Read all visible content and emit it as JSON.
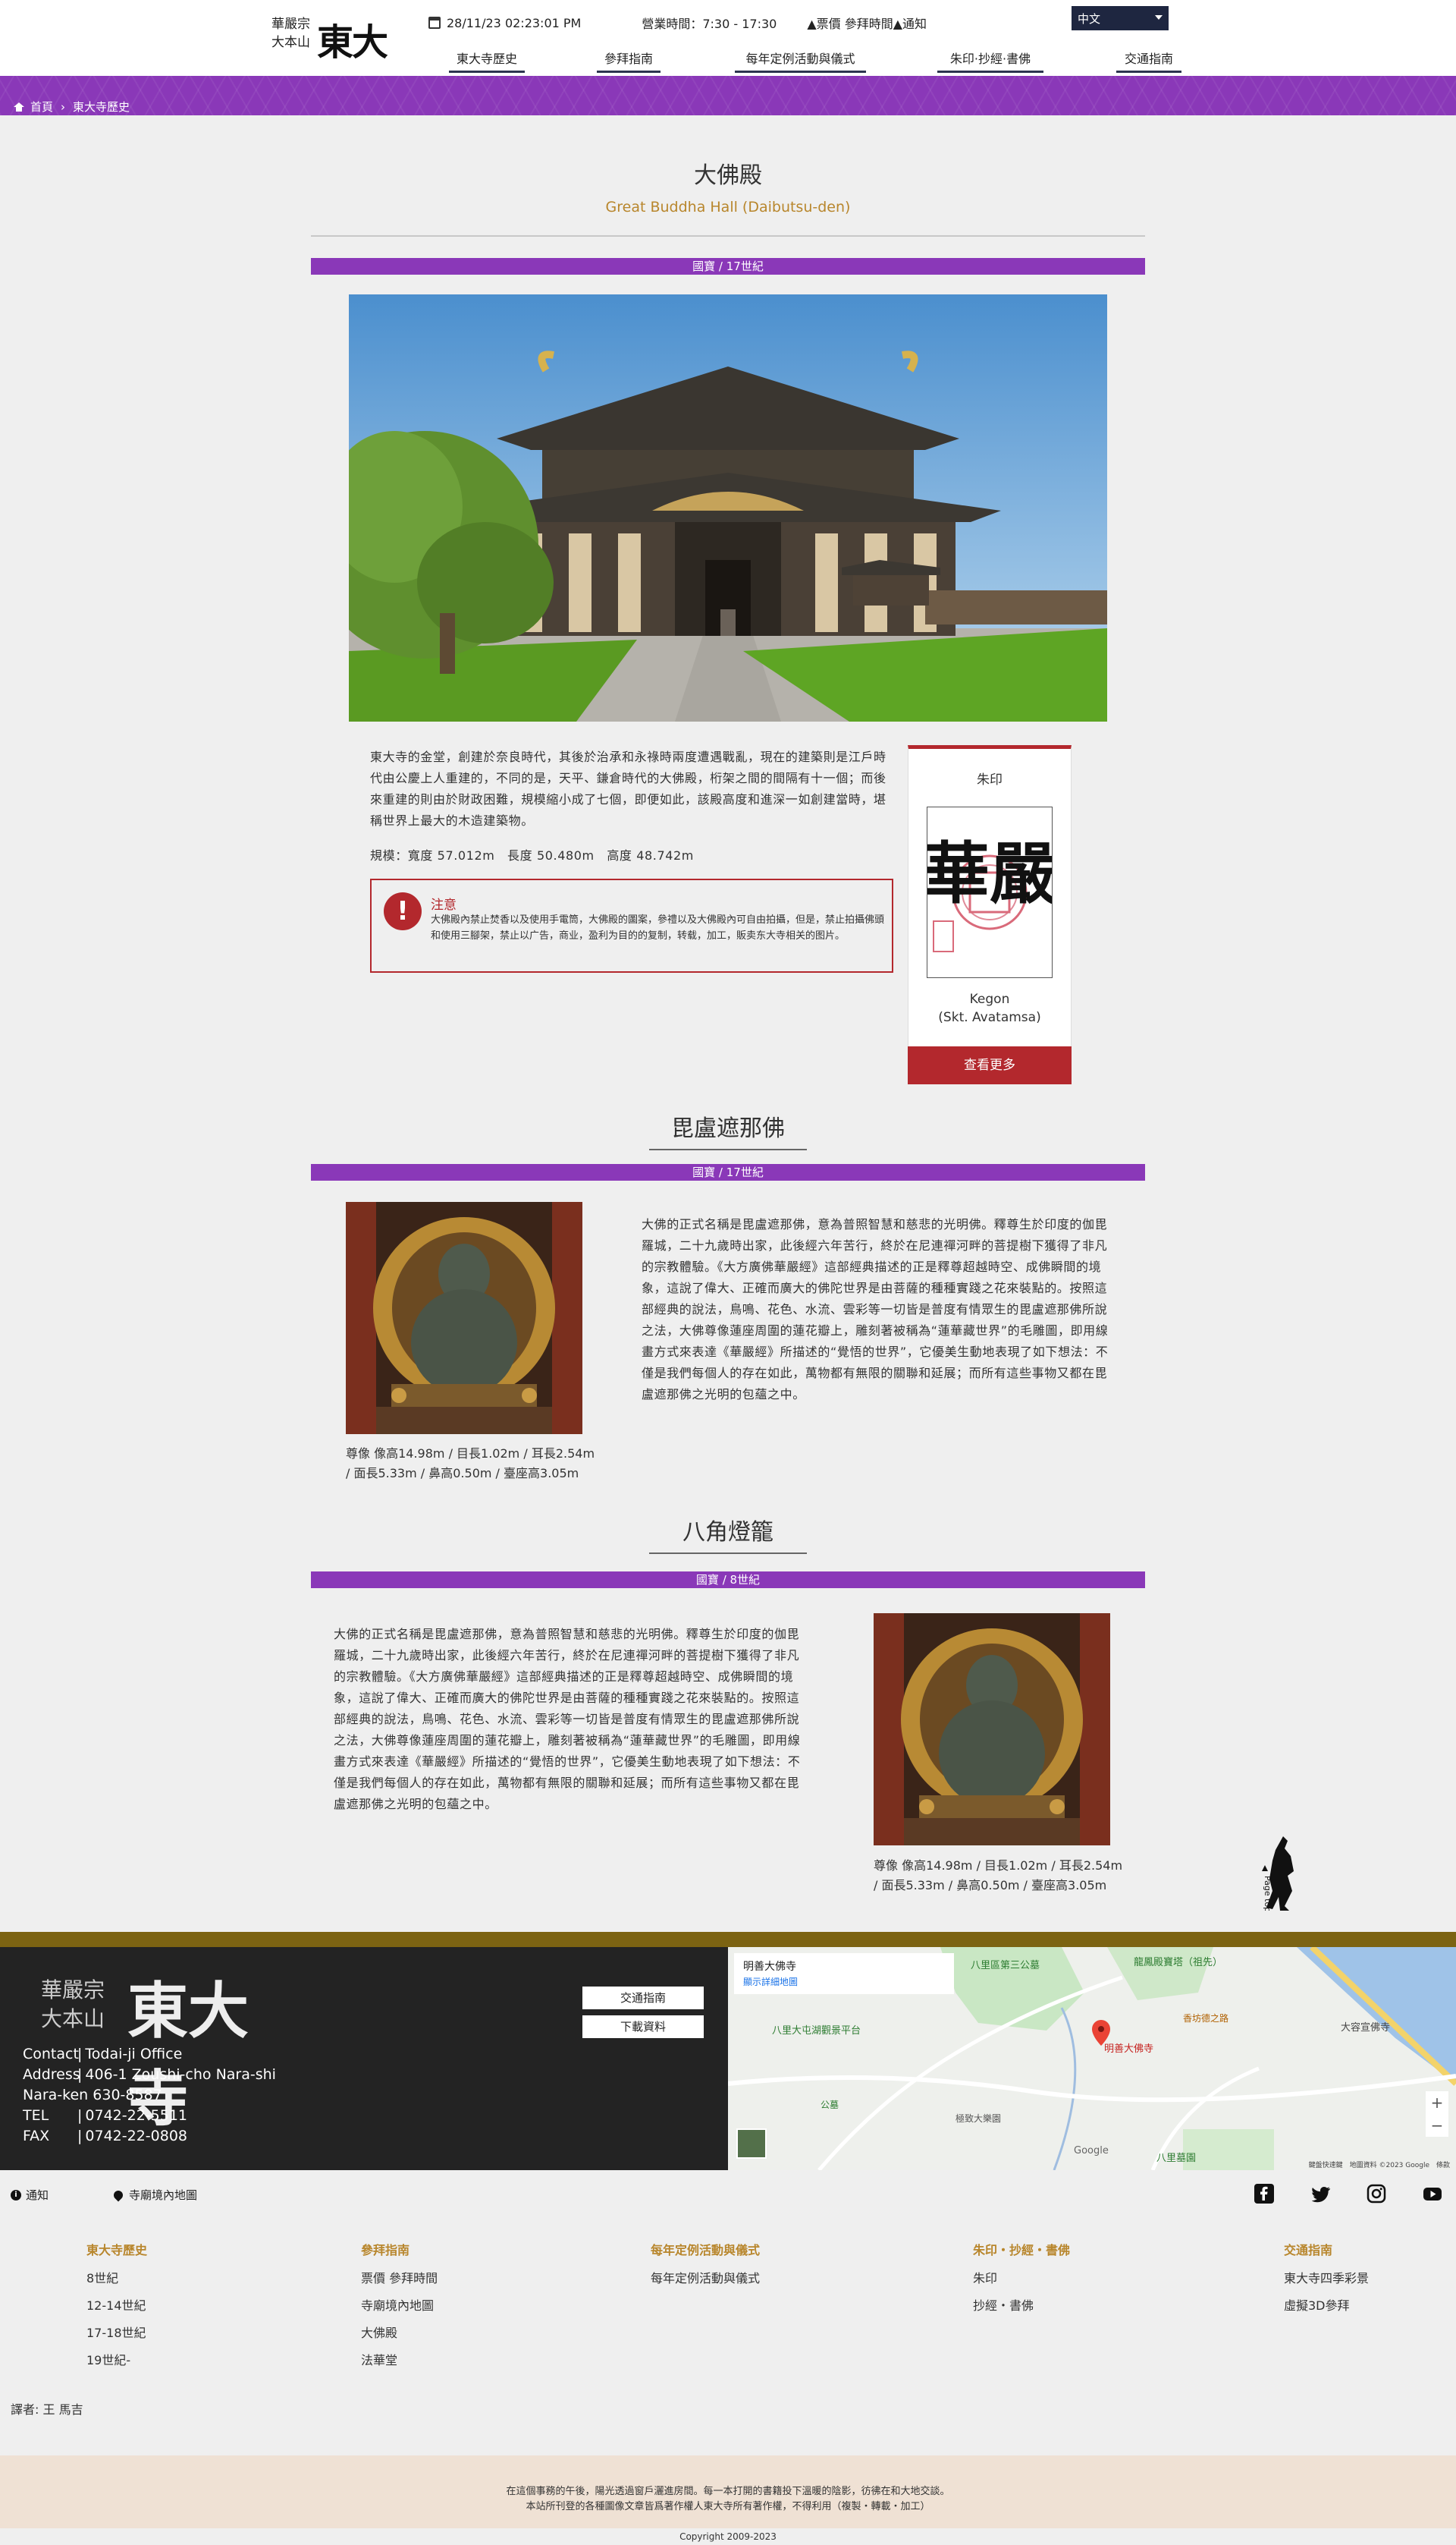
{
  "header": {
    "logo_sect": "華嚴宗\n大本山",
    "logo_mark": "東大寺",
    "datetime": "28/11/23  02:23:01 PM",
    "hours": "營業時間：7:30 - 17:30",
    "ticket_link": "▲票價 參拜時間",
    "notice_link": "▲通知",
    "language": "中文",
    "nav": [
      "東大寺歷史",
      "參拜指南",
      "每年定例活動與儀式",
      "朱印·抄經·書佛",
      "交通指南"
    ]
  },
  "breadcrumb": {
    "home": "首頁",
    "current": "東大寺歷史"
  },
  "daibutsuden": {
    "title": "大佛殿",
    "subtitle": "Great Buddha Hall (Daibutsu-den)",
    "ribbon": "國寶 / 17世紀",
    "body": "東大寺的金堂，創建於奈良時代，其後於治承和永祿時兩度遭遇戰亂，現在的建築則是江戶時代由公慶上人重建的，不同的是，天平、鎌倉時代的大佛殿，桁架之間的間隔有十一個；而後來重建的則由於財政困難，規模縮小成了七個，即便如此，該殿高度和進深一如創建當時，堪稱世界上最大的木造建築物。",
    "specs": "規模：寬度 57.012m　長度 50.480m　高度 48.742m",
    "notice_title": "注意",
    "notice_text": "大佛殿內禁止焚香以及使用手電筒，大佛殿的圖案，參禮以及大佛殿內可自由拍攝，但是，禁止拍攝佛頭和使用三腳架，禁止以广告，商业，盈利为目的的复制，转载，加工，販卖东大寺相关的图片。"
  },
  "shuin_card": {
    "heading": "朱印",
    "seal_glyph": "華嚴",
    "caption_1": "Kegon",
    "caption_2": "(Skt. Avatamsa)",
    "button": "查看更多"
  },
  "vairocana": {
    "title": "毘盧遮那佛",
    "ribbon": "國寶 / 17世紀",
    "body": "大佛的正式名稱是毘盧遮那佛，意為普照智慧和慈悲的光明佛。釋尊生於印度的伽毘羅城，二十九歲時出家，此後經六年苦行，終於在尼連禪河畔的菩提樹下獲得了非凡的宗教體驗。《大方廣佛華嚴經》這部經典描述的正是釋尊超越時空、成佛瞬間的境象，這說了偉大、正確而廣大的佛陀世界是由菩薩的種種實踐之花來裝點的。按照這部經典的說法，鳥鳴、花色、水流、雲彩等一切皆是普度有情眾生的毘盧遮那佛所說之法，大佛尊像蓮座周圍的蓮花瓣上，雕刻著被稱為“蓮華藏世界”的毛雕圖，即用線畫方式來表達《華嚴經》所描述的“覺悟的世界”，它優美生動地表現了如下想法：不僅是我們每個人的存在如此，萬物都有無限的關聯和延展；而所有這些事物又都在毘盧遮那佛之光明的包蘊之中。",
    "caption": "尊像 像高14.98m / 目長1.02m / 耳長2.54m / 面長5.33m / 鼻高0.50m / 臺座高3.05m"
  },
  "lantern": {
    "title": "八角燈籠",
    "ribbon": "國寶 / 8世紀",
    "body": "大佛的正式名稱是毘盧遮那佛，意為普照智慧和慈悲的光明佛。釋尊生於印度的伽毘羅城，二十九歲時出家，此後經六年苦行，終於在尼連禪河畔的菩提樹下獲得了非凡的宗教體驗。《大方廣佛華嚴經》這部經典描述的正是釋尊超越時空、成佛瞬間的境象，這說了偉大、正確而廣大的佛陀世界是由菩薩的種種實踐之花來裝點的。按照這部經典的說法，鳥鳴、花色、水流、雲彩等一切皆是普度有情眾生的毘盧遮那佛所說之法，大佛尊像蓮座周圍的蓮花瓣上，雕刻著被稱為“蓮華藏世界”的毛雕圖，即用線畫方式來表達《華嚴經》所描述的“覺悟的世界”，它優美生動地表現了如下想法：不僅是我們每個人的存在如此，萬物都有無限的關聯和延展；而所有這些事物又都在毘盧遮那佛之光明的包蘊之中。",
    "caption": "尊像 像高14.98m / 目長1.02m / 耳長2.54m / 面長5.33m / 鼻高0.50m / 臺座高3.05m"
  },
  "page_top": "Page top",
  "footer": {
    "logo_sect": "華嚴宗\n大本山",
    "logo_mark": "東大寺",
    "contact_label": "Contact",
    "contact_value": "Todai-ji Office",
    "address_label": "Address",
    "address_value": "406-1 Zoushi-cho Nara-shi",
    "address_line2": "Nara-ken 630-8587",
    "tel_label": "TEL",
    "tel_value": "0742-22-5511",
    "fax_label": "FAX",
    "fax_value": "0742-22-0808",
    "btn_access": "交通指南",
    "btn_download": "下載資料",
    "map": {
      "place_title": "明善大佛寺",
      "place_link": "顯示詳細地圖",
      "pin_label": "明善大佛寺",
      "labels": [
        "八里區第三公墓",
        "龍鳳殿寶塔（祖先）",
        "八里大屯湖觀景平台",
        "香坊德之路",
        "大容宣佛寺",
        "公墓",
        "極致大樂園",
        "八里墓園"
      ],
      "google": "Google",
      "terms": "鍵盤快速鍵　地圖資料 ©2023 Google　條款"
    },
    "sub_links": {
      "notice": "通知",
      "map": "寺廟境內地圖"
    },
    "columns": [
      {
        "heading": "東大寺歷史",
        "items": [
          "8世紀",
          "12-14世紀",
          "17-18世紀",
          "19世紀-"
        ]
      },
      {
        "heading": "參拜指南",
        "items": [
          "票價 參拜時間",
          "寺廟境內地圖",
          "大佛殿",
          "法華堂"
        ]
      },
      {
        "heading": "每年定例活動與儀式",
        "items": [
          "每年定例活動與儀式"
        ]
      },
      {
        "heading": "朱印・抄經・書佛",
        "items": [
          "朱印",
          "抄經・書佛"
        ]
      },
      {
        "heading": "交通指南",
        "items": [
          "東大寺四季彩景",
          "虛擬3D參拜"
        ]
      }
    ],
    "translator": "譯者: 王 馬吉",
    "pink_line1": "在這個事務的午後，陽光透過窗戶灑進房間。每一本打開的書籍投下溫暖的陰影，彷彿在和大地交談。",
    "pink_line2": "本站所刊登的各種圖像文章皆爲著作權人東大寺所有著作權，不得利用（複製・轉載・加工）",
    "copyright": "Copyright 2009-2023"
  },
  "colors": {
    "purple": "#8a38b8",
    "red": "#b3282d",
    "gold": "#b8862c",
    "navy": "#2c3550"
  }
}
